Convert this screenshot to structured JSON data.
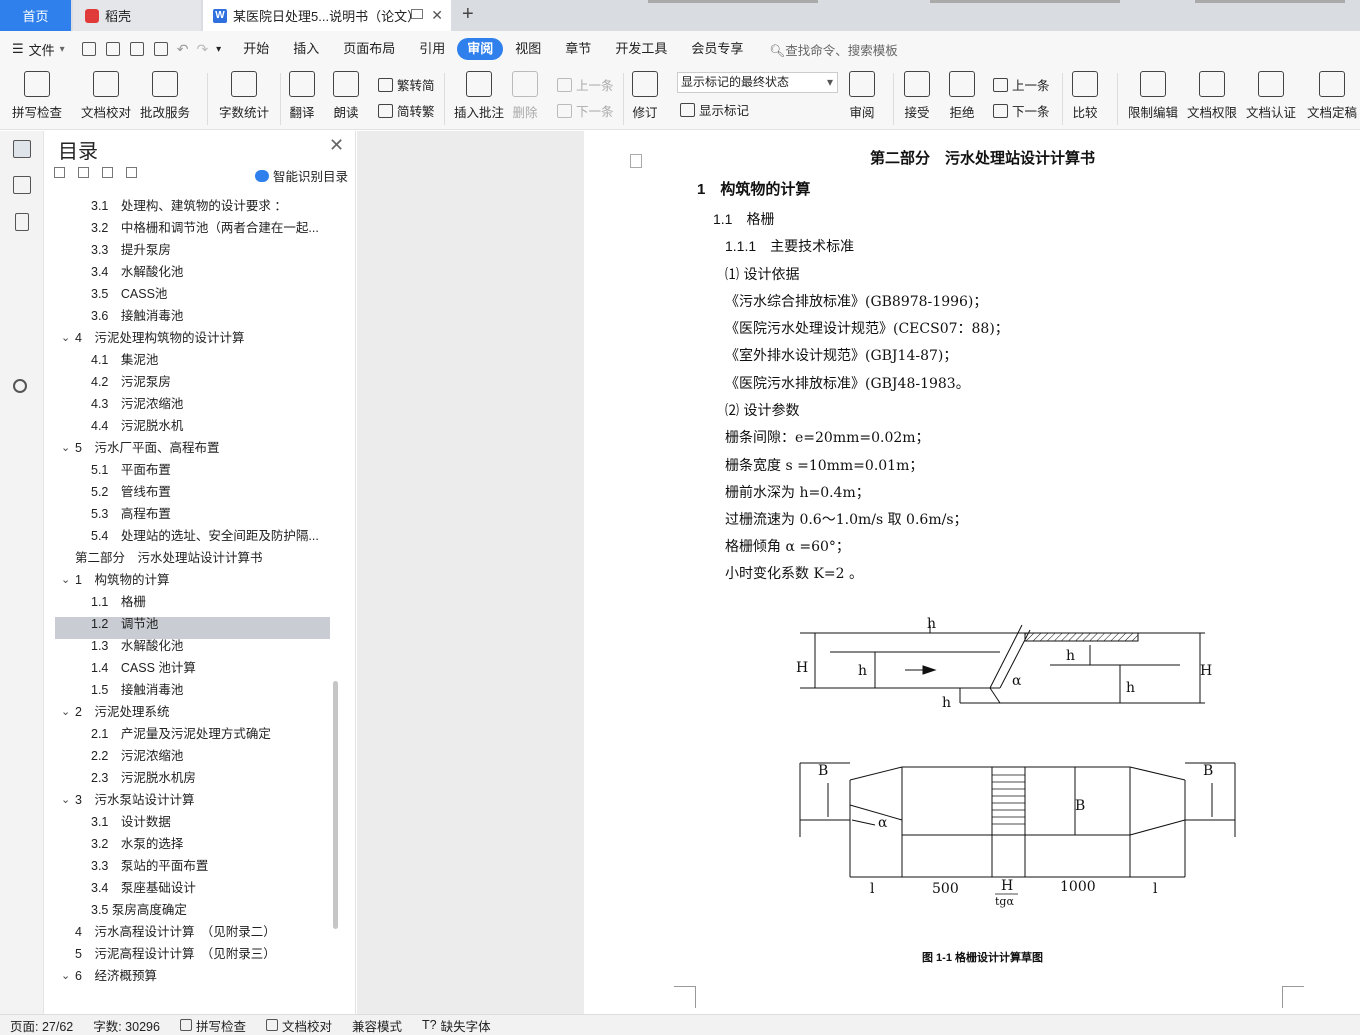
{
  "tabs": {
    "home": "首页",
    "daoke": "稻壳",
    "doc": "某医院日处理5...说明书（论文）"
  },
  "menu": {
    "file": "文件",
    "items": [
      "开始",
      "插入",
      "页面布局",
      "引用",
      "审阅",
      "视图",
      "章节",
      "开发工具",
      "会员专享"
    ],
    "active": "审阅",
    "search": "查找命令、搜索模板"
  },
  "ribbon": {
    "spell": "拼写检查",
    "proof": "文档校对",
    "annot": "批改服务",
    "wordcount": "字数统计",
    "translate": "翻译",
    "read": "朗读",
    "t2s": "繁转简",
    "s2t": "简转繁",
    "insert_comment": "插入批注",
    "delete": "删除",
    "prev_c": "上一条",
    "next_c": "下一条",
    "revise": "修订",
    "markup_state": "显示标记的最终状态",
    "show_markup": "显示标记",
    "review": "审阅",
    "accept": "接受",
    "reject": "拒绝",
    "prev": "上一条",
    "next": "下一条",
    "compare": "比较",
    "restrict": "限制编辑",
    "permission": "文档权限",
    "certify": "文档认证",
    "finalize": "文档定稿"
  },
  "toc": {
    "title": "目录",
    "smart": "智能识别目录",
    "items": [
      {
        "n": "3.1",
        "t": "处理构、建筑物的设计要求 ：",
        "lvl": 2
      },
      {
        "n": "3.2",
        "t": "中格栅和调节池（两者合建在一起...",
        "lvl": 2
      },
      {
        "n": "3.3",
        "t": "提升泵房",
        "lvl": 2
      },
      {
        "n": "3.4",
        "t": "水解酸化池",
        "lvl": 2
      },
      {
        "n": "3.5",
        "t": "CASS池",
        "lvl": 2
      },
      {
        "n": "3.6",
        "t": "接触消毒池",
        "lvl": 2
      },
      {
        "n": "4",
        "t": "污泥处理构筑物的设计计算",
        "lvl": 1,
        "open": true
      },
      {
        "n": "4.1",
        "t": "集泥池",
        "lvl": 2
      },
      {
        "n": "4.2",
        "t": "污泥泵房",
        "lvl": 2
      },
      {
        "n": "4.3",
        "t": "污泥浓缩池",
        "lvl": 2
      },
      {
        "n": "4.4",
        "t": "污泥脱水机",
        "lvl": 2
      },
      {
        "n": "5",
        "t": "污水厂平面、高程布置",
        "lvl": 1,
        "open": true
      },
      {
        "n": "5.1",
        "t": "平面布置",
        "lvl": 2
      },
      {
        "n": "5.2",
        "t": "管线布置",
        "lvl": 2
      },
      {
        "n": "5.3",
        "t": "高程布置",
        "lvl": 2
      },
      {
        "n": "5.4",
        "t": "处理站的选址、安全间距及防护隔...",
        "lvl": 2
      },
      {
        "n": "",
        "t": "第二部分　污水处理站设计计算书",
        "lvl": 0
      },
      {
        "n": "1",
        "t": "构筑物的计算",
        "lvl": 1,
        "open": true
      },
      {
        "n": "1.1",
        "t": "格栅",
        "lvl": 2
      },
      {
        "n": "1.2",
        "t": "调节池",
        "lvl": 2
      },
      {
        "n": "1.3",
        "t": "水解酸化池",
        "lvl": 2
      },
      {
        "n": "1.4",
        "t": "CASS 池计算",
        "lvl": 2
      },
      {
        "n": "1.5",
        "t": "接触消毒池",
        "lvl": 2
      },
      {
        "n": "2",
        "t": "污泥处理系统",
        "lvl": 1,
        "open": true
      },
      {
        "n": "2.1",
        "t": "产泥量及污泥处理方式确定",
        "lvl": 2
      },
      {
        "n": "2.2",
        "t": "污泥浓缩池",
        "lvl": 2
      },
      {
        "n": "2.3",
        "t": "污泥脱水机房",
        "lvl": 2
      },
      {
        "n": "3",
        "t": "污水泵站设计计算",
        "lvl": 1,
        "open": true
      },
      {
        "n": "3.1",
        "t": "设计数据",
        "lvl": 2
      },
      {
        "n": "3.2",
        "t": "水泵的选择",
        "lvl": 2
      },
      {
        "n": "3.3",
        "t": "泵站的平面布置",
        "lvl": 2
      },
      {
        "n": "3.4",
        "t": "泵座基础设计",
        "lvl": 2
      },
      {
        "n": "3.5",
        "t": "泵房高度确定",
        "lvl": 3
      },
      {
        "n": "4",
        "t": "污水高程设计计算　（见附录二）",
        "lvl": 1
      },
      {
        "n": "5",
        "t": "污泥高程设计计算　（见附录三）",
        "lvl": 1
      },
      {
        "n": "6",
        "t": "经济概预算",
        "lvl": 1,
        "open": true
      }
    ]
  },
  "doc": {
    "part": "第二部分　污水处理站设计计算书",
    "h1": "1　构筑物的计算",
    "h2": "1.1　格栅",
    "h3": "1.1.1　主要技术标准",
    "p1": "⑴ 设计依据",
    "s1": "《污水综合排放标准》(GB8978-1996)；",
    "s2": "《医院污水处理设计规范》(CECS07：88)；",
    "s3": "《室外排水设计规范》(GBJ14-87)；",
    "s4": "《医院污水排放标准》(GBJ48-1983。",
    "p2": "⑵ 设计参数",
    "d1": "栅条间隙：e=20mm=0.02m；",
    "d2": "栅条宽度 s =10mm=0.01m；",
    "d3": "栅前水深为 h=0.4m；",
    "d4": "过栅流速为 0.6～1.0m/s 取 0.6m/s；",
    "d5": "格栅倾角 α =60°；",
    "d6": "小时变化系数 K=2 。",
    "fig_caption": "图 1-1  格栅设计计算草图",
    "fig_labels": {
      "H1": "H",
      "h2": "h",
      "h": "h",
      "h1": "h",
      "alpha": "α",
      "H": "H",
      "h_low": "h",
      "hb": "h",
      "B1": "B",
      "B": "B",
      "alpha1": "α",
      "l1": "l",
      "d500": "500",
      "Htg": "H",
      "tg": "tgα",
      "d1000": "1000",
      "l2": "l"
    }
  },
  "status": {
    "page": "页面: 27/62",
    "words": "字数: 30296",
    "spell": "拼写检查",
    "proof": "文档校对",
    "compat": "兼容模式",
    "missing_font": "缺失字体"
  }
}
